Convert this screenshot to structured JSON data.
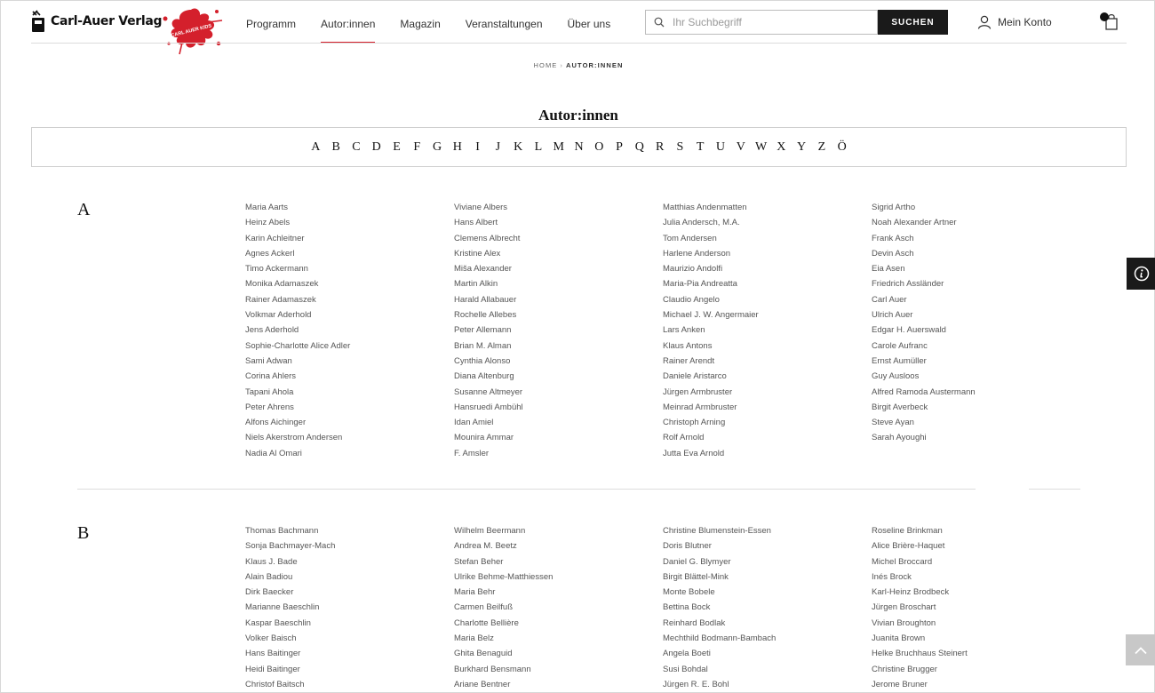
{
  "header": {
    "logo_text": "Carl-Auer Verlag",
    "kids_logo_text": "CARL AUER KIDS",
    "nav": [
      {
        "label": "Programm",
        "active": false
      },
      {
        "label": "Autor:innen",
        "active": true
      },
      {
        "label": "Magazin",
        "active": false
      },
      {
        "label": "Veranstaltungen",
        "active": false
      },
      {
        "label": "Über uns",
        "active": false
      }
    ],
    "search_placeholder": "Ihr Suchbegriff",
    "search_button": "SUCHEN",
    "account_label": "Mein Konto",
    "accent_color": "#d4202c"
  },
  "breadcrumb": {
    "home": "HOME",
    "separator": "›",
    "current": "AUTOR:INNEN"
  },
  "page_title": "Autor:innen",
  "alphabet": [
    "A",
    "B",
    "C",
    "D",
    "E",
    "F",
    "G",
    "H",
    "I",
    "J",
    "K",
    "L",
    "M",
    "N",
    "O",
    "P",
    "Q",
    "R",
    "S",
    "T",
    "U",
    "V",
    "W",
    "X",
    "Y",
    "Z",
    "Ö"
  ],
  "sections": [
    {
      "letter": "A",
      "columns": [
        [
          "Maria Aarts",
          "Heinz Abels",
          "Karin Achleitner",
          "Agnes Ackerl",
          "Timo Ackermann",
          "Monika Adamaszek",
          "Rainer Adamaszek",
          "Volkmar Aderhold",
          "Jens Aderhold",
          "Sophie-Charlotte Alice Adler",
          "Sami Adwan",
          "Corina Ahlers",
          "Tapani Ahola",
          "Peter Ahrens",
          "Alfons Aichinger",
          "Niels Akerstrom Andersen",
          "Nadia Al Omari"
        ],
        [
          "Viviane Albers",
          "Hans Albert",
          "Clemens Albrecht",
          "Kristine Alex",
          "Miša Alexander",
          "Martin Alkin",
          "Harald Allabauer",
          "Rochelle Allebes",
          "Peter Allemann",
          "Brian M. Alman",
          "Cynthia Alonso",
          "Diana Altenburg",
          "Susanne Altmeyer",
          "Hansruedi Ambühl",
          "Idan Amiel",
          "Mounira Ammar",
          "F. Amsler"
        ],
        [
          "Matthias Andenmatten",
          "Julia Andersch, M.A.",
          "Tom Andersen",
          "Harlene Anderson",
          "Maurizio Andolfi",
          "Maria-Pia Andreatta",
          "Claudio Angelo",
          "Michael J. W. Angermaier",
          "Lars Anken",
          "Klaus Antons",
          "Rainer Arendt",
          "Daniele Aristarco",
          "Jürgen Armbruster",
          "Meinrad Armbruster",
          "Christoph Arning",
          "Rolf Arnold",
          "Jutta Eva Arnold"
        ],
        [
          "Sigrid Artho",
          "Noah Alexander Artner",
          "Frank Asch",
          "Devin Asch",
          "Eia Asen",
          "Friedrich Assländer",
          "Carl Auer",
          "Ulrich Auer",
          "Edgar H. Auerswald",
          "Carole Aufranc",
          "Ernst Aumüller",
          "Guy Ausloos",
          "Alfred Ramoda Austermann",
          "Birgit Averbeck",
          "Steve Ayan",
          "Sarah Ayoughi"
        ]
      ]
    },
    {
      "letter": "B",
      "columns": [
        [
          "Thomas Bachmann",
          "Sonja Bachmayer-Mach",
          "Klaus J. Bade",
          "Alain Badiou",
          "Dirk Baecker",
          "Marianne Baeschlin",
          "Kaspar Baeschlin",
          "Volker Baisch",
          "Hans Baitinger",
          "Heidi Baitinger",
          "Christof Baitsch"
        ],
        [
          "Wilhelm Beermann",
          "Andrea M. Beetz",
          "Stefan Beher",
          "Ulrike Behme-Matthiessen",
          "Maria Behr",
          "Carmen Beilfuß",
          "Charlotte Bellière",
          "Maria Belz",
          "Ghita Benaguid",
          "Burkhard Bensmann",
          "Ariane Bentner"
        ],
        [
          "Christine Blumenstein-Essen",
          "Doris Blutner",
          "Daniel G. Blymyer",
          "Birgit Blättel-Mink",
          "Monte Bobele",
          "Bettina Bock",
          "Reinhard Bodlak",
          "Mechthild Bodmann-Bambach",
          "Angela Boeti",
          "Susi Bohdal",
          "Jürgen R. E. Bohl"
        ],
        [
          "Roseline Brinkman",
          "Alice Brière-Haquet",
          "Michel Broccard",
          "Inés Brock",
          "Karl-Heinz Brodbeck",
          "Jürgen Broschart",
          "Vivian Broughton",
          "Juanita Brown",
          "Helke Bruchhaus Steinert",
          "Christine Brugger",
          "Jerome Bruner"
        ]
      ]
    }
  ]
}
